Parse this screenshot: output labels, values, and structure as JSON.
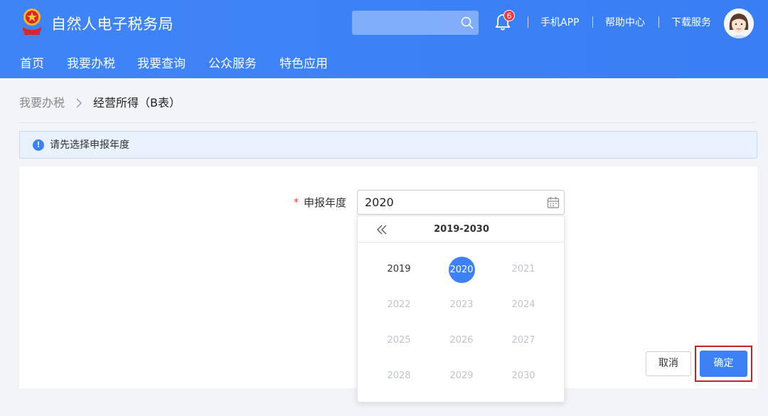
{
  "header": {
    "title": "自然人电子税务局",
    "search_placeholder": "",
    "notification_count": "6",
    "links": [
      "手机APP",
      "帮助中心",
      "下载服务"
    ]
  },
  "nav": {
    "items": [
      "首页",
      "我要办税",
      "我要查询",
      "公众服务",
      "特色应用"
    ]
  },
  "breadcrumb": {
    "parent": "我要办税",
    "current": "经营所得（B表）"
  },
  "notice": {
    "text": "请先选择申报年度"
  },
  "form": {
    "required_mark": "*",
    "year_label": "申报年度",
    "year_value": "2020"
  },
  "picker": {
    "range": "2019-2030",
    "years": [
      "2019",
      "2020",
      "2021",
      "2022",
      "2023",
      "2024",
      "2025",
      "2026",
      "2027",
      "2028",
      "2029",
      "2030"
    ],
    "selected": "2020",
    "enabled": [
      "2019",
      "2020"
    ]
  },
  "buttons": {
    "cancel": "取消",
    "confirm": "确定"
  },
  "colors": {
    "brand": "#3c82f6",
    "highlight": "#c3222a",
    "badge": "#f5383b"
  }
}
